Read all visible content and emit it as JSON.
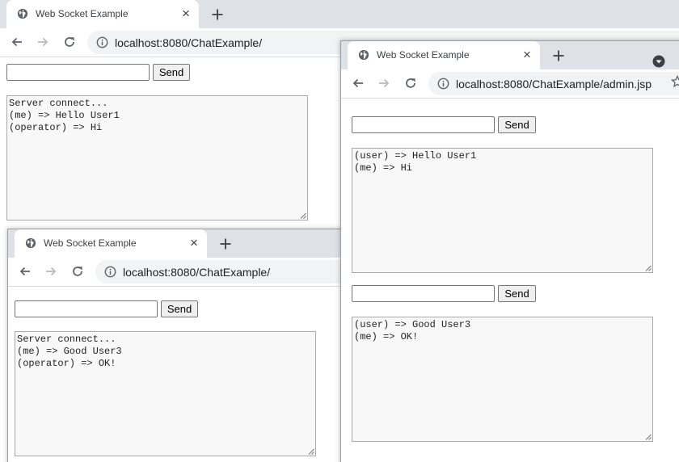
{
  "windows": {
    "main": {
      "tab_title": "Web Socket Example",
      "url": "localhost:8080/ChatExample/",
      "send_label": "Send",
      "log": [
        "Server connect...",
        "(me) => Hello User1",
        "(operator) => Hi"
      ]
    },
    "user3": {
      "tab_title": "Web Socket Example",
      "url": "localhost:8080/ChatExample/",
      "send_label": "Send",
      "log": [
        "Server connect...",
        "(me) => Good User3",
        "(operator) => OK!"
      ]
    },
    "admin": {
      "tab_title": "Web Socket Example",
      "url": "localhost:8080/ChatExample/admin.jsp",
      "sessions": [
        {
          "send_label": "Send",
          "log": [
            "(user) => Hello User1",
            "(me) => Hi"
          ]
        },
        {
          "send_label": "Send",
          "log": [
            "(user) => Good User3",
            "(me) => OK!"
          ]
        }
      ]
    }
  },
  "icons": {
    "favicon": "globe-icon",
    "close": "close-icon",
    "new_tab": "plus-icon",
    "back": "arrow-left-icon",
    "forward": "arrow-right-icon",
    "reload": "reload-icon",
    "info": "info-icon",
    "menu": "chevron-down-icon",
    "bookmark": "star-icon"
  },
  "colors": {
    "tabstrip": "#dee1e6",
    "omnibox": "#f1f3f4",
    "textarea_bg": "#f8f8f8"
  }
}
